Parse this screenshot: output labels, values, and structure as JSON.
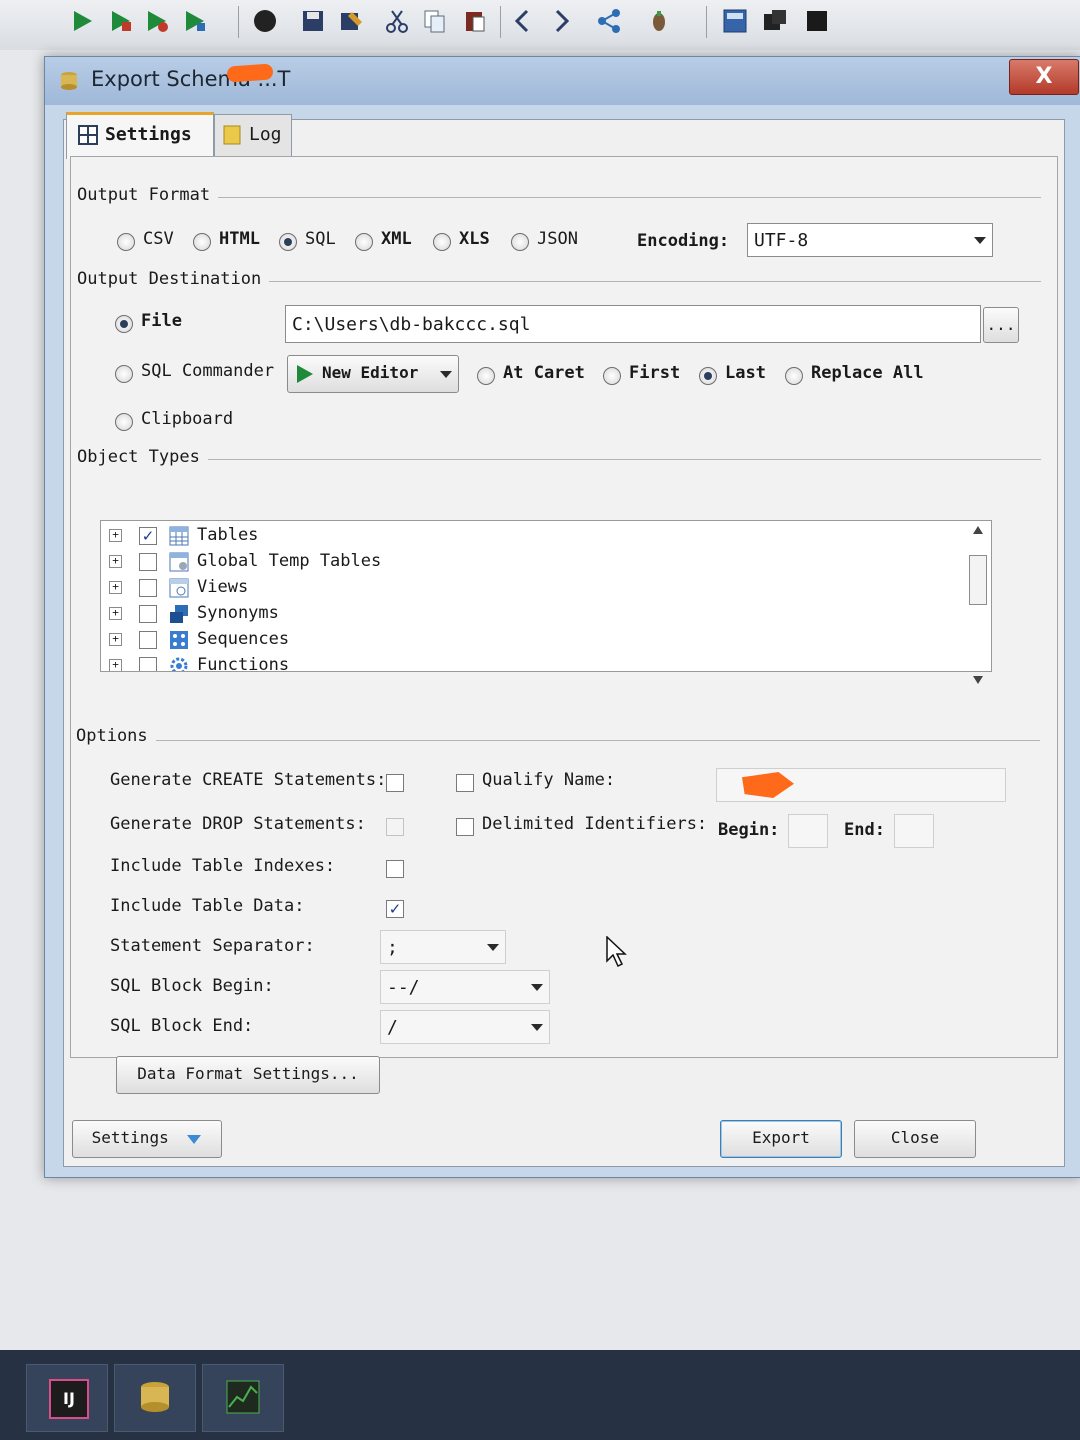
{
  "dialog": {
    "title": "Export Schema ...T",
    "close_label": "X"
  },
  "tabs": [
    {
      "label": "Settings",
      "active": true
    },
    {
      "label": "Log",
      "active": false
    }
  ],
  "output_format": {
    "group_label": "Output Format",
    "options": [
      "CSV",
      "HTML",
      "SQL",
      "XML",
      "XLS",
      "JSON"
    ],
    "selected": "SQL",
    "encoding_label": "Encoding:",
    "encoding_value": "UTF-8"
  },
  "output_destination": {
    "group_label": "Output Destination",
    "file_label": "File",
    "file_path": "C:\\Users\\db-bakccc.sql",
    "browse_label": "...",
    "sql_commander_label": "SQL Commander",
    "editor_label": "New Editor",
    "placement_options": [
      "At Caret",
      "First",
      "Last",
      "Replace All"
    ],
    "placement_selected": "Last",
    "clipboard_label": "Clipboard",
    "selected": "File"
  },
  "object_types": {
    "group_label": "Object Types",
    "items": [
      {
        "label": "Tables",
        "checked": true
      },
      {
        "label": "Global Temp Tables",
        "checked": false
      },
      {
        "label": "Views",
        "checked": false
      },
      {
        "label": "Synonyms",
        "checked": false
      },
      {
        "label": "Sequences",
        "checked": false
      },
      {
        "label": "Functions",
        "checked": false
      }
    ]
  },
  "options": {
    "group_label": "Options",
    "generate_create": {
      "label": "Generate CREATE Statements:",
      "checked": false
    },
    "generate_drop": {
      "label": "Generate DROP Statements:",
      "checked": false
    },
    "include_indexes": {
      "label": "Include Table Indexes:",
      "checked": false
    },
    "include_data": {
      "label": "Include Table Data:",
      "checked": true
    },
    "qualify_name": {
      "label": "Qualify Name:",
      "checked": false
    },
    "delimited_identifiers": {
      "label": "Delimited Identifiers:",
      "checked": false
    },
    "begin_label": "Begin:",
    "end_label": "End:",
    "statement_separator_label": "Statement Separator:",
    "statement_separator_value": ";",
    "sql_block_begin_label": "SQL Block Begin:",
    "sql_block_begin_value": "--/",
    "sql_block_end_label": "SQL Block End:",
    "sql_block_end_value": "/",
    "data_format_button": "Data Format Settings..."
  },
  "footer": {
    "settings_button": "Settings",
    "export_button": "Export",
    "close_button": "Close"
  },
  "taskbar": {
    "app_badge": "IJ"
  }
}
